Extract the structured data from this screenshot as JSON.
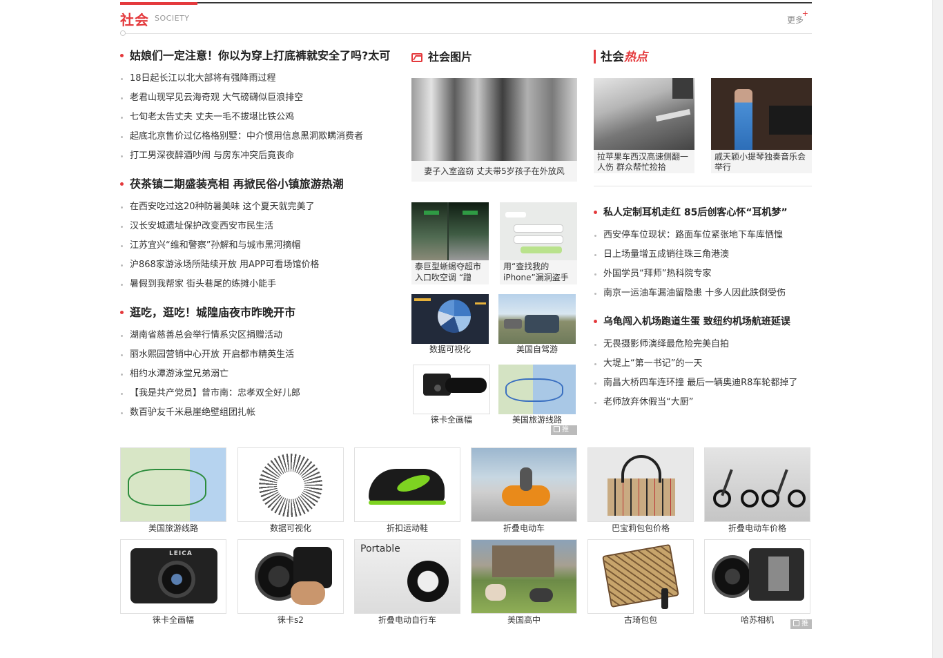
{
  "header": {
    "title": "社会",
    "subtitle": "SOCIETY",
    "more": "更多",
    "plus": "+"
  },
  "column1": {
    "groups": [
      {
        "headline": "姑娘们一定注意！你以为穿上打底裤就安全了吗?太可",
        "items": [
          "18日起长江以北大部将有强降雨过程",
          "老君山现罕见云海奇观 大气磅礴似巨浪排空",
          "七旬老太告丈夫 丈夫一毛不拔堪比铁公鸡",
          "起底北京售价过亿格格别墅：中介惯用信息黑洞欺瞒消费者",
          "打工男深夜醉酒吵闹 与房东冲突后竟丧命"
        ]
      },
      {
        "headline": "茯茶镇二期盛装亮相 再掀民俗小镇旅游热潮",
        "items": [
          "在西安吃过这20种防暑美味 这个夏天就完美了",
          "汉长安城遗址保护改变西安市民生活",
          "江苏宜兴“维和警察”孙解和与城市黑河摘帽",
          "沪868家游泳场所陆续开放 用APP可看场馆价格",
          "暑假到我帮家 街头巷尾的练摊小能手"
        ]
      },
      {
        "headline": "逛吃，逛吃！城隍庙夜市昨晚开市",
        "items": [
          "湖南省慈善总会举行情系灾区捐赠活动",
          "丽水熙园营销中心开放 开启都市精英生活",
          "相约水潭游泳堂兄弟溺亡",
          "【我是共产党员】曾市南：忠孝双全好儿郎",
          "数百驴友千米悬崖绝壁组团扎帐"
        ]
      }
    ]
  },
  "column2": {
    "heading": "社会图片",
    "big": {
      "caption": "妻子入室盗窃 丈夫带5岁孩子在外放风"
    },
    "thumbs": [
      {
        "caption": "泰巨型蜥蜴夺超市入口吹空调 “蹭"
      },
      {
        "caption": "用“查找我的iPhone”漏洞盗手"
      },
      {
        "caption": "数据可视化"
      },
      {
        "caption": "美国自驾游"
      },
      {
        "caption": "徕卡全画幅"
      },
      {
        "caption": "美国旅游线路"
      }
    ],
    "promo": "推广"
  },
  "column3": {
    "heading_a": "社会",
    "heading_b": "热点",
    "pics": [
      {
        "caption": "拉苹果车西汉高速侧翻一人伤 群众帮忙捡拾"
      },
      {
        "caption": "戚天颖小提琴独奏音乐会举行"
      }
    ],
    "groups": [
      {
        "headline": "私人定制耳机走红 85后创客心怀“耳机梦”",
        "items": [
          "西安停车位现状：路面车位紧张地下车库恓惶",
          "日上场量增五成销往珠三角港澳",
          "外国学员“拜师”热科院专家",
          "南京一运油车漏油留隐患 十多人因此跌倒受伤"
        ]
      },
      {
        "headline": "乌龟闯入机场跑道生蛋 致纽约机场航班延误",
        "items": [
          "无畏摄影师演绎最危险完美自拍",
          "大堤上“第一书记”的一天",
          "南昌大桥四车连环撞 最后一辆奥迪R8车轮都掉了",
          "老师放弃休假当“大厨”"
        ]
      }
    ]
  },
  "grid": {
    "row1": [
      {
        "caption": "美国旅游线路"
      },
      {
        "caption": "数据可视化"
      },
      {
        "caption": "折扣运动鞋"
      },
      {
        "caption": "折叠电动车"
      },
      {
        "caption": "巴宝莉包包价格"
      },
      {
        "caption": "折叠电动车价格"
      }
    ],
    "row2": [
      {
        "caption": "徕卡全画幅"
      },
      {
        "caption": "徕卡s2"
      },
      {
        "caption": "折叠电动自行车"
      },
      {
        "caption": "美国高中"
      },
      {
        "caption": "古琦包包"
      },
      {
        "caption": "哈苏相机"
      }
    ],
    "portable_text": "Portable",
    "leica_text": "LEICA",
    "promo": "推广"
  }
}
